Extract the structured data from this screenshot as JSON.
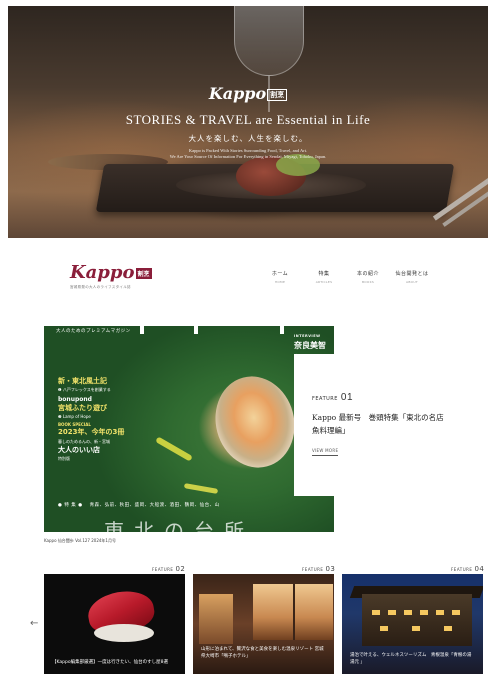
{
  "hero": {
    "logo": "Kappo",
    "logo_mark": "割烹",
    "tagline": "STORIES & TRAVEL are Essential in Life",
    "subtitle": "大人を楽しむ、人生を楽しむ。",
    "desc_line1": "Kappo is Packed With Stories Surrounding Food, Travel, and Art.",
    "desc_line2": "We Are Your Source Of Information For Everything in Sendai, Miyagi, Tohoku, Japan."
  },
  "brand": {
    "name": "Kappo",
    "mark": "割烹",
    "tagline": "宮城県発の大人のライフスタイル誌"
  },
  "nav": [
    {
      "jp": "ホーム",
      "en": "HOME"
    },
    {
      "jp": "特集",
      "en": "ARTICLES"
    },
    {
      "jp": "本の紹介",
      "en": "BOOKS"
    },
    {
      "jp": "仙台開発とは",
      "en": "ABOUT"
    }
  ],
  "cover": {
    "top_note": "大人のためのプレミアムマガジン",
    "interview_label": "INTERVIEW",
    "interview_name": "奈良美智",
    "interview_name2": "伊",
    "line1": "新・東北風土記",
    "line2": "❶ 八戸フレックスを創業する",
    "line3": "bonupond",
    "line4": "宮城ふたり遊び",
    "line5": "❷ Lamp of Hope",
    "line6": "BOOK SPECIAL",
    "line7": "2023年、今年の3冊",
    "line8": "暮しのためるんの、新・宮城",
    "line9": "大人のいい店",
    "line10": "特別版",
    "places": "● 特 集 ●　 青森、弘前、秋田、盛岡、大船渡、酒田、鶴岡、仙台、山",
    "big_text": "東北の台所"
  },
  "cover_caption": "Kappo 仙台闊歩 Vol.127 2024年1月号",
  "feature01": {
    "label": "FEATURE",
    "number": "01",
    "title": "Kappo 最新号　巻頭特集「東北の名店 魚料理編」",
    "more": "VIEW MORE"
  },
  "cards": [
    {
      "label": "FEATURE",
      "number": "02",
      "caption": "【Kappo編集部厳選】一度は行きたい、仙台のすし屋8選"
    },
    {
      "label": "FEATURE",
      "number": "03",
      "caption": "山形に泊まれて、贅沢な食と美食を楽しむ温泉リゾート 宮城県大崎市「鳴子ホテル」"
    },
    {
      "label": "FEATURE",
      "number": "04",
      "caption": "湯治で叶える、ウェルネスツーリズム　青根温泉「青根の湯 湯元 」"
    }
  ],
  "prev_arrow": "←"
}
